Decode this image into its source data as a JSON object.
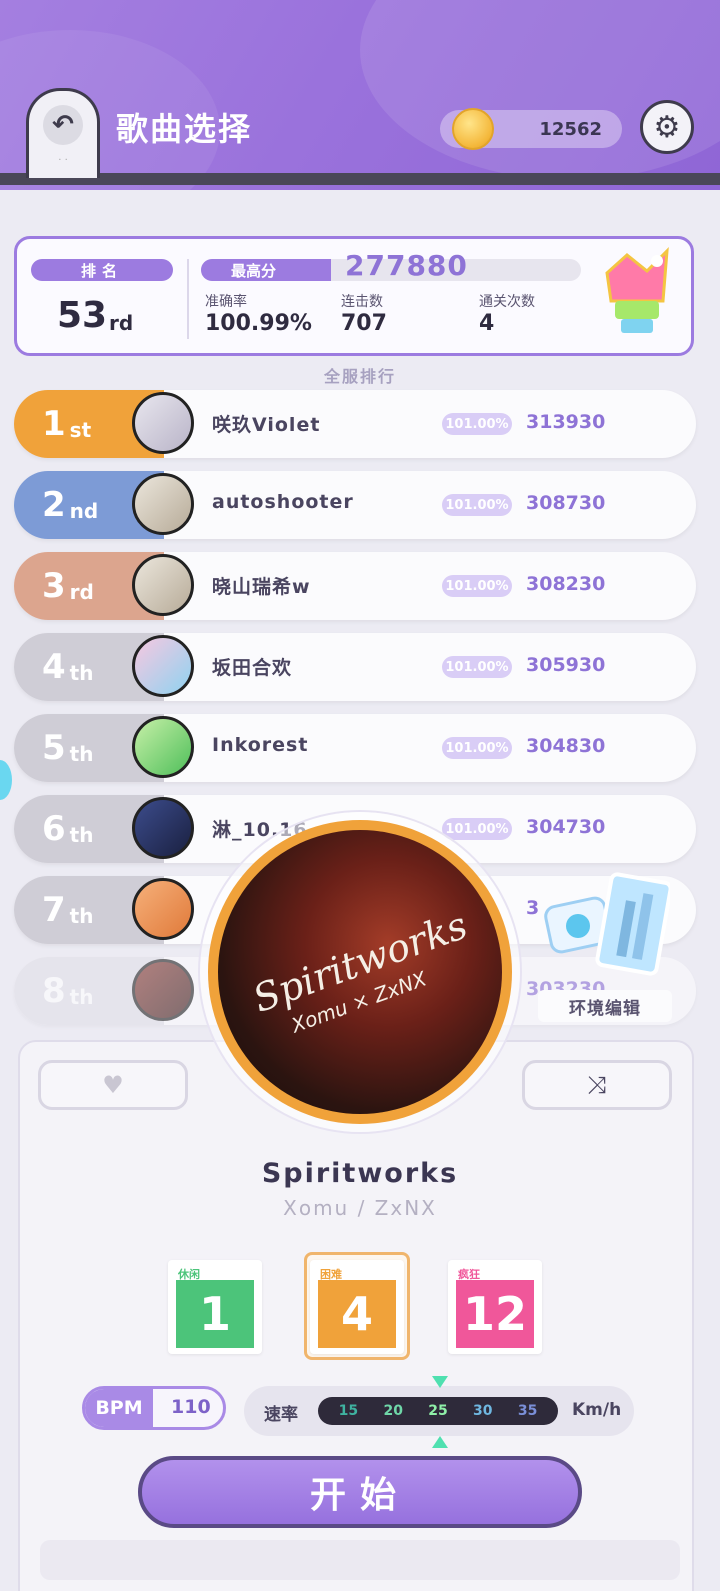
{
  "header": {
    "title": "歌曲选择",
    "coins": "12562",
    "back_icon": "undo-arrow-icon",
    "settings_icon": "gear-icon"
  },
  "stats": {
    "rank_label": "排名",
    "rank_value": "53",
    "rank_suffix": "rd",
    "best_label": "最高分",
    "best_score": "277880",
    "accuracy_label": "准确率",
    "accuracy_value": "100.99%",
    "combo_label": "连击数",
    "combo_value": "707",
    "clears_label": "通关次数",
    "clears_value": "4"
  },
  "leaderboard": {
    "heading": "全服排行",
    "rows": [
      {
        "rank": "1",
        "suffix": "st",
        "name": "咲玖Violet",
        "acc": "101.00%",
        "score": "313930",
        "color": "#f0a23a"
      },
      {
        "rank": "2",
        "suffix": "nd",
        "name": "autoshooter",
        "acc": "101.00%",
        "score": "308730",
        "color": "#7d9bd6"
      },
      {
        "rank": "3",
        "suffix": "rd",
        "name": "晓山瑞希w",
        "acc": "101.00%",
        "score": "308230",
        "color": "#dca58e"
      },
      {
        "rank": "4",
        "suffix": "th",
        "name": "坂田合欢",
        "acc": "101.00%",
        "score": "305930",
        "color": "#cfcdd6"
      },
      {
        "rank": "5",
        "suffix": "th",
        "name": "Inkorest",
        "acc": "101.00%",
        "score": "304830",
        "color": "#cfcdd6"
      },
      {
        "rank": "6",
        "suffix": "th",
        "name": "淋_10.16",
        "acc": "101.00%",
        "score": "304730",
        "color": "#cfcdd6"
      },
      {
        "rank": "7",
        "suffix": "th",
        "name": "",
        "acc": "",
        "score": "3",
        "color": "#cfcdd6"
      },
      {
        "rank": "8",
        "suffix": "th",
        "name": "",
        "acc": "",
        "score": "303230",
        "color": "#e2e0e8"
      }
    ]
  },
  "album": {
    "art_title": "Spiritworks",
    "art_subtitle": "Xomu × ZxNX"
  },
  "environment": {
    "label": "环境编辑"
  },
  "song": {
    "title": "Spiritworks",
    "artist": "Xomu / ZxNX"
  },
  "difficulties": [
    {
      "label": "休闲",
      "level": "1",
      "color": "#4cc47a"
    },
    {
      "label": "困难",
      "level": "4",
      "color": "#f0a23a",
      "selected": true
    },
    {
      "label": "疯狂",
      "level": "12",
      "color": "#f0579a"
    }
  ],
  "bpm": {
    "label": "BPM",
    "value": "110"
  },
  "speed": {
    "label": "速率",
    "options": [
      "15",
      "20",
      "25",
      "30",
      "35"
    ],
    "selected": "25",
    "unit": "Km/h"
  },
  "start_button": "开始",
  "icons": {
    "favorite": "heart-icon",
    "shuffle": "shuffle-icon"
  }
}
